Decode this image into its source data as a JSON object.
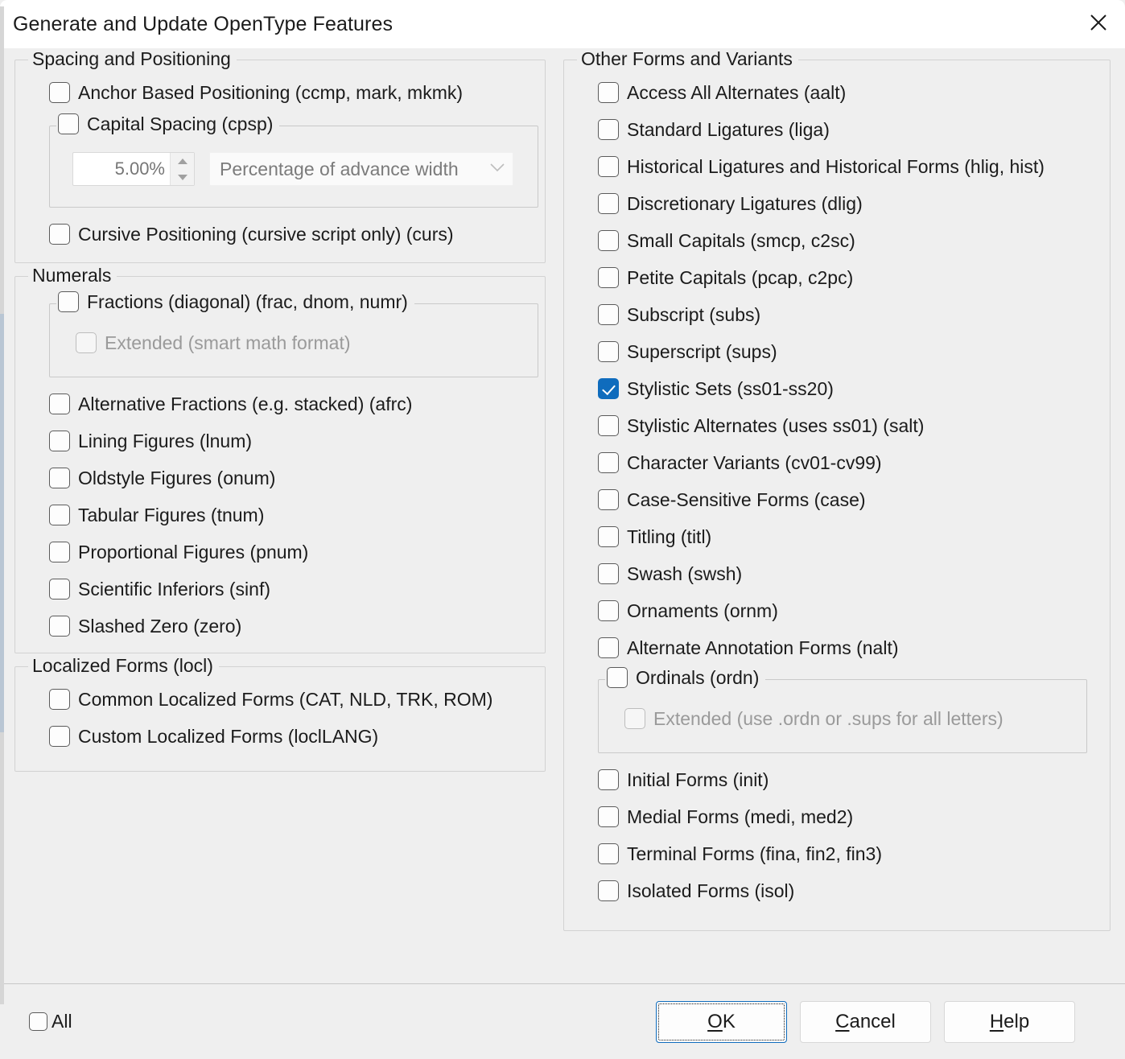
{
  "window": {
    "title": "Generate and Update OpenType Features",
    "close_icon": "close-icon"
  },
  "left_column": {
    "spacing_group": {
      "legend": "Spacing and Positioning",
      "items": [
        {
          "label": "Anchor Based Positioning (ccmp, mark, mkmk)",
          "checked": false
        }
      ],
      "capital_spacing": {
        "label": "Capital Spacing (cpsp)",
        "checked": false,
        "spin_value": "5.00%",
        "combo_value": "Percentage of advance width"
      },
      "items_after": [
        {
          "label": "Cursive Positioning (cursive script only) (curs)",
          "checked": false
        }
      ]
    },
    "numerals_group": {
      "legend": "Numerals",
      "fractions": {
        "label": "Fractions (diagonal) (frac, dnom, numr)",
        "checked": false,
        "extended": {
          "label": "Extended (smart math format)",
          "checked": false,
          "disabled": true
        }
      },
      "items": [
        {
          "label": "Alternative Fractions (e.g. stacked) (afrc)",
          "checked": false
        },
        {
          "label": "Lining Figures (lnum)",
          "checked": false
        },
        {
          "label": "Oldstyle Figures (onum)",
          "checked": false
        },
        {
          "label": "Tabular Figures (tnum)",
          "checked": false
        },
        {
          "label": "Proportional Figures (pnum)",
          "checked": false
        },
        {
          "label": "Scientific Inferiors (sinf)",
          "checked": false
        },
        {
          "label": "Slashed Zero (zero)",
          "checked": false
        }
      ]
    },
    "localized_group": {
      "legend": "Localized Forms (locl)",
      "items": [
        {
          "label": "Common Localized Forms (CAT, NLD, TRK, ROM)",
          "checked": false
        },
        {
          "label": "Custom Localized Forms (loclLANG)",
          "checked": false
        }
      ]
    }
  },
  "right_column": {
    "other_group": {
      "legend": "Other Forms and Variants",
      "items_top": [
        {
          "label": "Access All Alternates (aalt)",
          "checked": false
        },
        {
          "label": "Standard Ligatures (liga)",
          "checked": false
        },
        {
          "label": "Historical Ligatures and Historical Forms (hlig, hist)",
          "checked": false
        },
        {
          "label": "Discretionary Ligatures (dlig)",
          "checked": false
        },
        {
          "label": "Small Capitals (smcp, c2sc)",
          "checked": false
        },
        {
          "label": "Petite Capitals (pcap, c2pc)",
          "checked": false
        },
        {
          "label": "Subscript (subs)",
          "checked": false
        },
        {
          "label": "Superscript (sups)",
          "checked": false
        },
        {
          "label": "Stylistic Sets (ss01-ss20)",
          "checked": true
        },
        {
          "label": "Stylistic Alternates (uses ss01) (salt)",
          "checked": false
        },
        {
          "label": "Character Variants (cv01-cv99)",
          "checked": false
        },
        {
          "label": "Case-Sensitive Forms (case)",
          "checked": false
        },
        {
          "label": "Titling (titl)",
          "checked": false
        },
        {
          "label": "Swash (swsh)",
          "checked": false
        },
        {
          "label": "Ornaments (ornm)",
          "checked": false
        },
        {
          "label": "Alternate Annotation Forms (nalt)",
          "checked": false
        }
      ],
      "ordinals": {
        "label": "Ordinals (ordn)",
        "checked": false,
        "extended": {
          "label": "Extended (use .ordn or .sups for all letters)",
          "checked": false,
          "disabled": true
        }
      },
      "items_bottom": [
        {
          "label": "Initial Forms (init)",
          "checked": false
        },
        {
          "label": "Medial Forms (medi, med2)",
          "checked": false
        },
        {
          "label": "Terminal Forms (fina, fin2, fin3)",
          "checked": false
        },
        {
          "label": "Isolated Forms (isol)",
          "checked": false
        }
      ]
    }
  },
  "footer": {
    "all_label": "All",
    "all_checked": false,
    "buttons": [
      {
        "label": "OK",
        "accel": "O",
        "focused": true
      },
      {
        "label": "Cancel",
        "accel": "C",
        "focused": false
      },
      {
        "label": "Help",
        "accel": "H",
        "focused": false
      }
    ]
  },
  "colors": {
    "accent": "#0f6cbd",
    "background": "#efefef",
    "titlebar": "#ffffff",
    "text": "#1b1b1b",
    "disabled_text": "#9a9a9a"
  }
}
